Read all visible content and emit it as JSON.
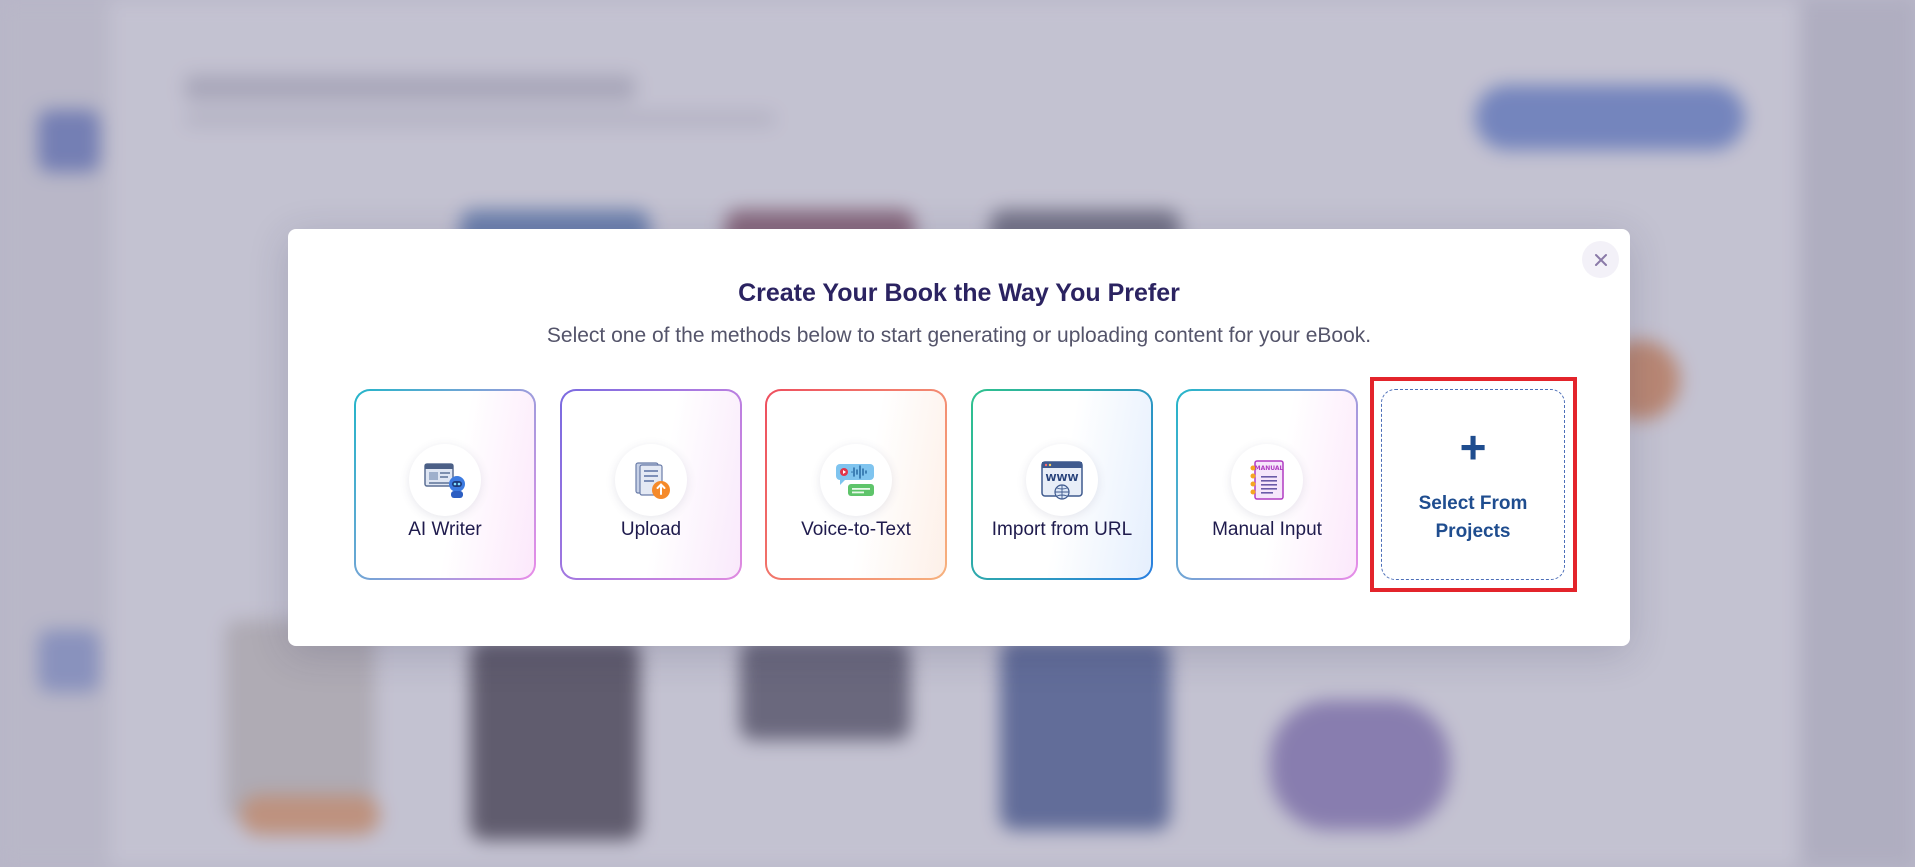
{
  "modal": {
    "title": "Create Your Book the Way You Prefer",
    "subtitle": "Select one of the methods below to start generating or uploading content for your eBook.",
    "close_label": "×",
    "options": [
      {
        "label": "AI Writer",
        "icon": "ai-writer-icon"
      },
      {
        "label": "Upload",
        "icon": "document-upload-icon"
      },
      {
        "label": "Voice-to-Text",
        "icon": "voice-chat-icon"
      },
      {
        "label": "Import from URL",
        "icon": "www-globe-icon"
      },
      {
        "label": "Manual Input",
        "icon": "manual-notebook-icon",
        "icon_text": "MANUAL"
      },
      {
        "label": "Select From Projects",
        "icon": "plus-icon",
        "icon_text": "+"
      }
    ]
  },
  "colors": {
    "title": "#2b2361",
    "projects_accent": "#1f4d8f",
    "highlight": "#e3242b"
  }
}
